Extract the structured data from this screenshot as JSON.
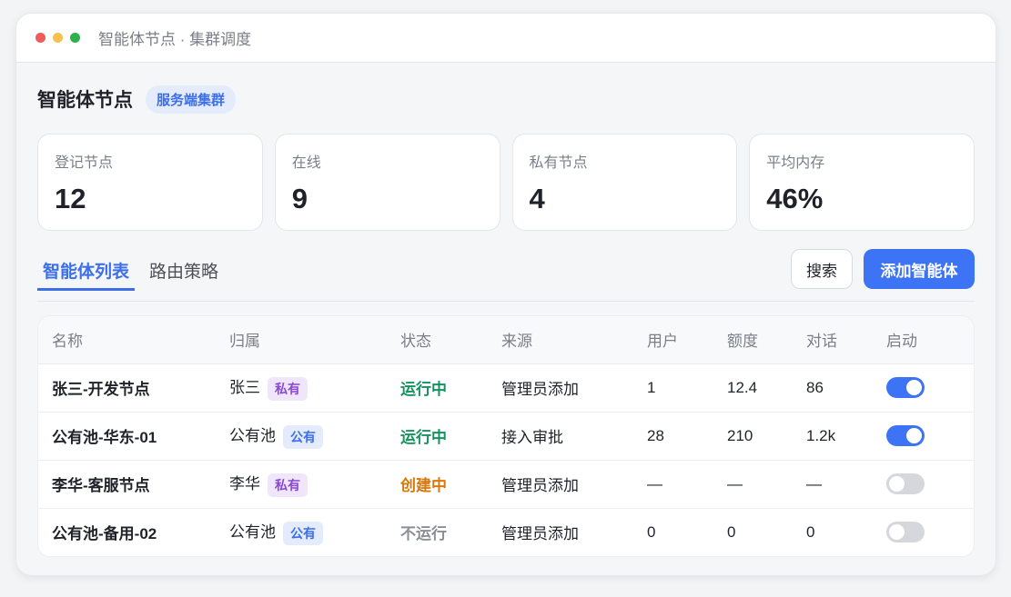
{
  "window": {
    "title": "智能体节点 · 集群调度"
  },
  "header": {
    "title": "智能体节点",
    "badge": "服务端集群"
  },
  "stats": [
    {
      "label": "登记节点",
      "value": "12"
    },
    {
      "label": "在线",
      "value": "9"
    },
    {
      "label": "私有节点",
      "value": "4"
    },
    {
      "label": "平均内存",
      "value": "46%"
    }
  ],
  "tabs": [
    {
      "label": "智能体列表",
      "active": true
    },
    {
      "label": "路由策略",
      "active": false
    }
  ],
  "actions": {
    "search": "搜索",
    "add": "添加智能体"
  },
  "table": {
    "columns": [
      "名称",
      "归属",
      "状态",
      "来源",
      "用户",
      "额度",
      "对话",
      "启动"
    ],
    "rows": [
      {
        "name": "张三-开发节点",
        "owner": "张三",
        "tag": "私有",
        "tag_type": "private",
        "status": "运行中",
        "status_color": "#15925e",
        "source": "管理员添加",
        "users": "1",
        "quota": "12.4",
        "chats": "86",
        "enabled": true
      },
      {
        "name": "公有池-华东-01",
        "owner": "公有池",
        "tag": "公有",
        "tag_type": "public",
        "status": "运行中",
        "status_color": "#15925e",
        "source": "接入审批",
        "users": "28",
        "quota": "210",
        "chats": "1.2k",
        "enabled": true
      },
      {
        "name": "李华-客服节点",
        "owner": "李华",
        "tag": "私有",
        "tag_type": "private",
        "status": "创建中",
        "status_color": "#d9780b",
        "source": "管理员添加",
        "users": "—",
        "quota": "—",
        "chats": "—",
        "enabled": false
      },
      {
        "name": "公有池-备用-02",
        "owner": "公有池",
        "tag": "公有",
        "tag_type": "public",
        "status": "不运行",
        "status_color": "#8a8f96",
        "source": "管理员添加",
        "users": "0",
        "quota": "0",
        "chats": "0",
        "enabled": false
      }
    ]
  },
  "colors": {
    "accent": "#3d74f5",
    "running": "#15925e",
    "creating": "#d9780b",
    "stopped": "#8a8f96"
  }
}
